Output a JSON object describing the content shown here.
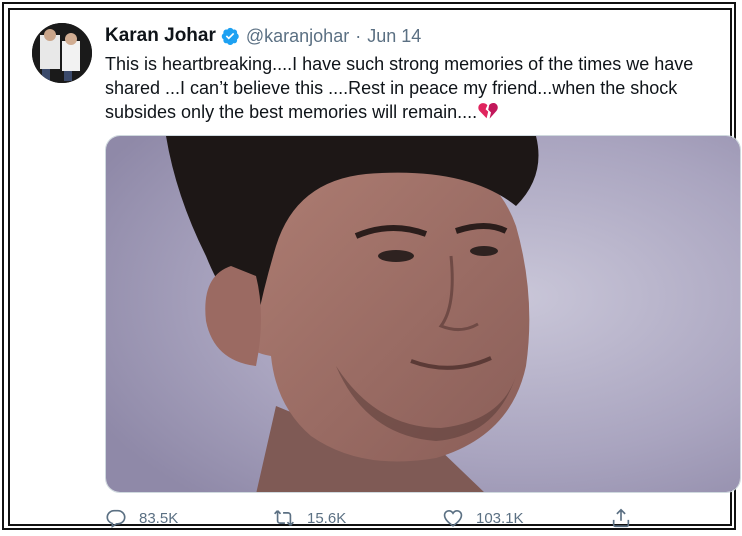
{
  "tweet": {
    "author_name": "Karan Johar",
    "handle": "@karanjohar",
    "separator": "·",
    "date": "Jun 14",
    "text": "This is heartbreaking....I have such strong memories of the times we have shared ...I can’t believe this ....Rest in peace my friend...when the shock subsides only the best memories will remain....",
    "emoji_icon": "broken-heart-icon",
    "verified_icon": "verified-badge-icon"
  },
  "actions": {
    "reply": {
      "count": "83.5K",
      "icon": "reply-icon"
    },
    "retweet": {
      "count": "15.6K",
      "icon": "retweet-icon"
    },
    "like": {
      "count": "103.1K",
      "icon": "like-icon"
    },
    "share": {
      "icon": "share-icon"
    }
  },
  "colors": {
    "text": "#0f1419",
    "secondary": "#5b7083",
    "verified": "#1da1f2",
    "broken_heart": "#e0245e"
  }
}
